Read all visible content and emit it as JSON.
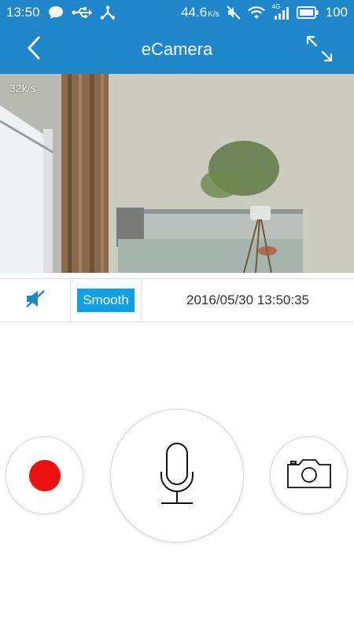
{
  "status_bar": {
    "time": "13:50",
    "network_speed": "44.6",
    "network_speed_unit": "K/s",
    "network_type": "4G",
    "battery": "100",
    "icons": [
      "chat-bubble-icon",
      "usb-icon",
      "share-icon",
      "mute-icon",
      "wifi-icon",
      "signal-icon",
      "battery-icon"
    ]
  },
  "header": {
    "title": "eCamera",
    "back_icon": "chevron-left-icon",
    "fullscreen_icon": "expand-icon"
  },
  "video": {
    "bitrate": "32k/s"
  },
  "controls": {
    "mute_icon": "speaker-muted-icon",
    "quality_label": "Smooth",
    "timestamp": "2016/05/30 13:50:35"
  },
  "actions": {
    "record_icon": "record-dot-icon",
    "talk_icon": "microphone-icon",
    "snapshot_icon": "camera-icon"
  },
  "colors": {
    "brand": "#1f86c9",
    "accent": "#10a0e8",
    "record": "#ee1111"
  }
}
